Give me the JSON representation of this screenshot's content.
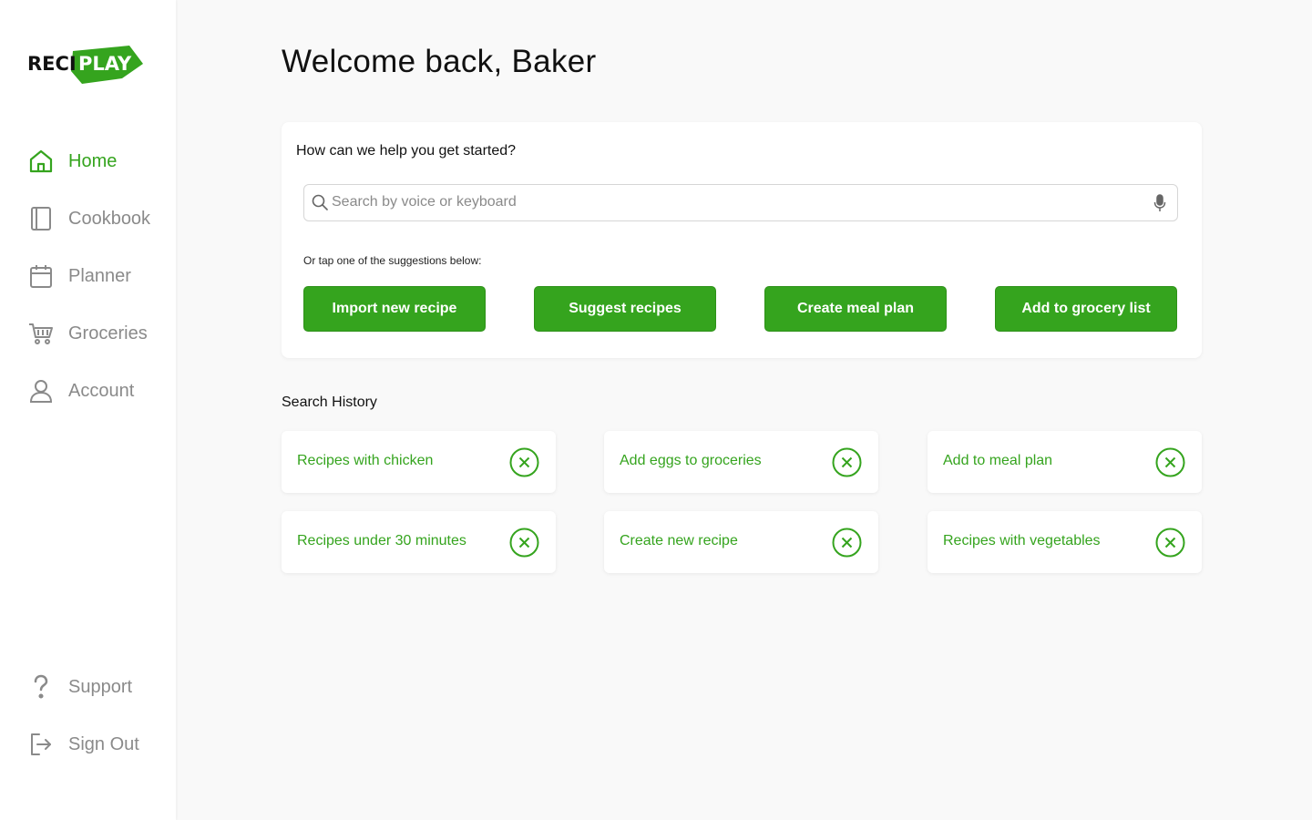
{
  "brand": {
    "logo_text_left": "RECI",
    "logo_text_right": "PLAY",
    "accent": "#35a41e"
  },
  "sidebar": {
    "items": [
      {
        "label": "Home",
        "icon": "home-icon",
        "active": true
      },
      {
        "label": "Cookbook",
        "icon": "book-icon",
        "active": false
      },
      {
        "label": "Planner",
        "icon": "calendar-icon",
        "active": false
      },
      {
        "label": "Groceries",
        "icon": "cart-icon",
        "active": false
      },
      {
        "label": "Account",
        "icon": "user-icon",
        "active": false
      }
    ],
    "bottom_items": [
      {
        "label": "Support",
        "icon": "question-icon"
      },
      {
        "label": "Sign Out",
        "icon": "sign-out-icon"
      }
    ]
  },
  "main": {
    "title": "Welcome back, Baker",
    "start_card": {
      "heading": "How can we help you get started?",
      "search_placeholder": "Search by voice or keyboard",
      "search_value": "",
      "suggest_hint": "Or tap one of the suggestions below:",
      "buttons": [
        "Import new recipe",
        "Suggest recipes",
        "Create meal plan",
        "Add to grocery list"
      ]
    },
    "history": {
      "heading": "Search History",
      "items": [
        "Recipes with chicken",
        "Add eggs to groceries",
        "Add to meal plan",
        "Recipes under 30 minutes",
        "Create new recipe",
        "Recipes with vegetables"
      ]
    }
  }
}
